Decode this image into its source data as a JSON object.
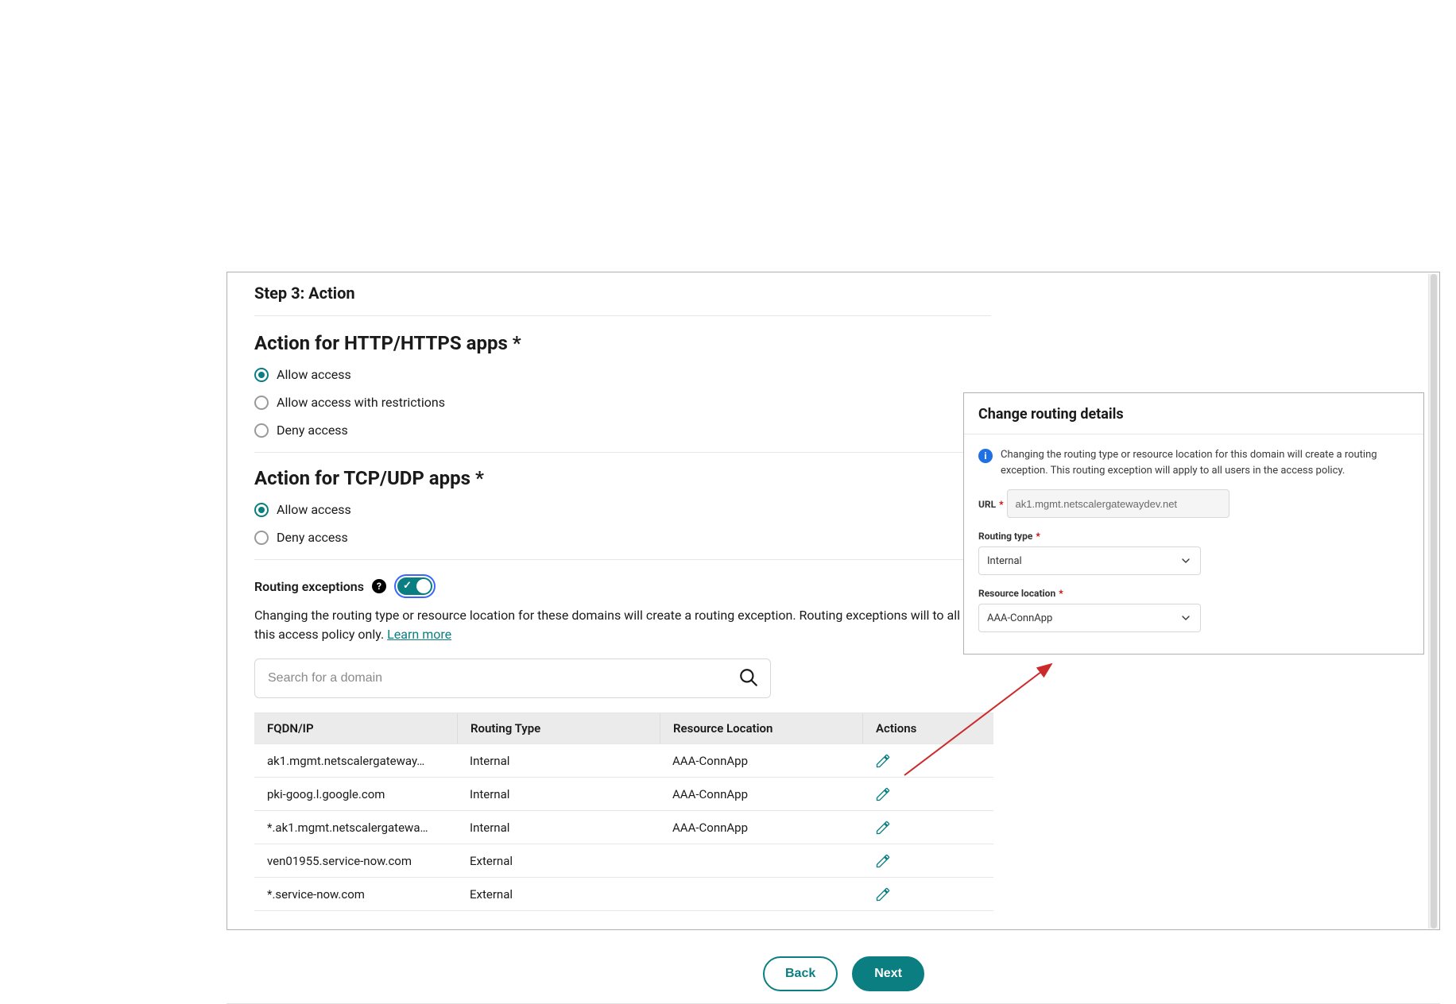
{
  "step": {
    "title": "Step 3: Action"
  },
  "httpSection": {
    "title": "Action for HTTP/HTTPS apps *",
    "options": {
      "allow": "Allow access",
      "allow_restrictions": "Allow access with restrictions",
      "deny": "Deny access"
    },
    "selected": "allow"
  },
  "tcpSection": {
    "title": "Action for TCP/UDP apps *",
    "options": {
      "allow": "Allow access",
      "deny": "Deny access"
    },
    "selected": "allow"
  },
  "routingExceptions": {
    "label": "Routing exceptions",
    "helpIcon": "?",
    "enabled": true,
    "description_prefix": "Changing the routing type or resource location for these domains will create a routing exception. Routing exceptions will to all users in this access policy only. ",
    "learn_more": "Learn more"
  },
  "search": {
    "placeholder": "Search for a domain"
  },
  "table": {
    "headers": {
      "fqdn": "FQDN/IP",
      "routing_type": "Routing Type",
      "resource_location": "Resource Location",
      "actions": "Actions"
    },
    "rows": [
      {
        "fqdn": "ak1.mgmt.netscalergateway…",
        "routing_type": "Internal",
        "resource_location": "AAA-ConnApp"
      },
      {
        "fqdn": "pki-goog.l.google.com",
        "routing_type": "Internal",
        "resource_location": "AAA-ConnApp"
      },
      {
        "fqdn": "*.ak1.mgmt.netscalergatewa…",
        "routing_type": "Internal",
        "resource_location": "AAA-ConnApp"
      },
      {
        "fqdn": "ven01955.service-now.com",
        "routing_type": "External",
        "resource_location": ""
      },
      {
        "fqdn": "*.service-now.com",
        "routing_type": "External",
        "resource_location": ""
      }
    ]
  },
  "footer": {
    "back": "Back",
    "next": "Next"
  },
  "popover": {
    "title": "Change routing details",
    "info": "Changing the routing type or resource location for this domain will create a routing exception. This routing exception will apply to all users in the access policy.",
    "fields": {
      "url_label": "URL",
      "url_value": "ak1.mgmt.netscalergatewaydev.net",
      "routing_type_label": "Routing type",
      "routing_type_value": "Internal",
      "resource_location_label": "Resource location",
      "resource_location_value": "AAA-ConnApp"
    }
  },
  "icons": {
    "pencil": "pencil-icon",
    "search": "search-icon",
    "chevron": "chevron-down-icon",
    "info": "info-icon",
    "help": "help-icon"
  },
  "colors": {
    "teal": "#0a7e80",
    "accent_blue": "#3a66ff",
    "arrow_red": "#cc2a2a"
  }
}
